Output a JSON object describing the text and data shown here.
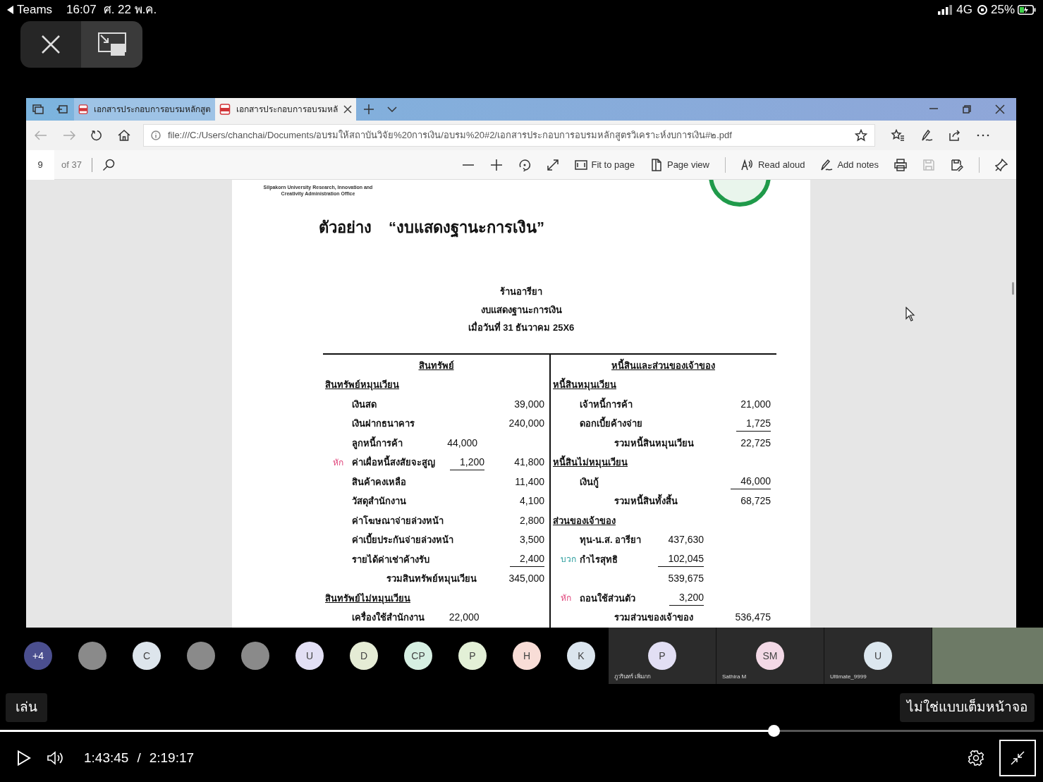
{
  "status_bar": {
    "app": "Teams",
    "time": "16:07",
    "date": "ศ. 22 พ.ค.",
    "network": "4G",
    "battery": "25%"
  },
  "browser": {
    "tabs": [
      {
        "label": "เอกสารประกอบการอบรมหลักสูต",
        "selected": false
      },
      {
        "label": "เอกสารประกอบการอบรมหลั",
        "selected": true
      }
    ],
    "address": "file:///C:/Users/chanchai/Documents/อบรมให้สถาบันวิจัย%20การเงิน/อบรม%20#2/เอกสารประกอบการอบรมหลักสูตรวิเคราะห์งบการเงิน#๒.pdf",
    "pdf_toolbar": {
      "page": "9",
      "page_count": "of 37",
      "buttons": [
        {
          "kind": "fit",
          "label": "Fit to page"
        },
        {
          "kind": "view",
          "label": "Page view"
        },
        {
          "kind": "read",
          "label": "Read aloud"
        },
        {
          "kind": "notes",
          "label": "Add notes"
        }
      ]
    }
  },
  "document": {
    "org": "Silpakorn University Research, Innovation and Creativity Administration Office",
    "title_prefix": "ตัวอย่าง",
    "title": "“งบแสดงฐานะการเงิน”",
    "header": [
      "ร้านอารียา",
      "งบแสดงฐานะการเงิน",
      "เมื่อวันที่ 31 ธันวาคม 25X6"
    ],
    "left": [
      {
        "kind": "heading",
        "label": "สินทรัพย์"
      },
      {
        "kind": "section",
        "label": "สินทรัพย์หมุนเวียน"
      },
      {
        "kind": "item",
        "label": "เงินสด",
        "b": "39,000",
        "b_ruled": false
      },
      {
        "kind": "item",
        "label": "เงินฝากธนาคาร",
        "b": "240,000",
        "b_ruled": false
      },
      {
        "kind": "item",
        "label": "ลูกหนี้การค้า",
        "a": "44,000",
        "a_ruled": false
      },
      {
        "kind": "item",
        "prefix": "หัก",
        "color": "#e0457b",
        "label": "ค่าเผื่อหนี้สงสัยจะสูญ",
        "a": "1,200",
        "a_ruled": true,
        "b": "41,800",
        "b_ruled": false
      },
      {
        "kind": "item",
        "label": "สินค้าคงเหลือ",
        "b": "11,400",
        "b_ruled": false
      },
      {
        "kind": "item",
        "label": "วัสดุสำนักงาน",
        "b": "4,100",
        "b_ruled": false
      },
      {
        "kind": "item",
        "label": "ค่าโฆษณาจ่ายล่วงหน้า",
        "b": "2,800",
        "b_ruled": false
      },
      {
        "kind": "item",
        "label": "ค่าเบี้ยประกันจ่ายล่วงหน้า",
        "b": "3,500",
        "b_ruled": false
      },
      {
        "kind": "item",
        "label": "รายได้ค่าเช่าค้างรับ",
        "b": "2,400",
        "b_ruled": true
      },
      {
        "kind": "total",
        "label": "รวมสินทรัพย์หมุนเวียน",
        "b": "345,000",
        "b_ruled": false
      },
      {
        "kind": "section",
        "label": "สินทรัพย์ไม่หมุนเวียน"
      },
      {
        "kind": "item",
        "label": "เครื่องใช้สำนักงาน",
        "a": "22,000",
        "a_ruled": false
      }
    ],
    "right": [
      {
        "kind": "heading",
        "label": "หนี้สินและส่วนของเจ้าของ"
      },
      {
        "kind": "section",
        "label": "หนี้สินหมุนเวียน"
      },
      {
        "kind": "item",
        "label": "เจ้าหนี้การค้า",
        "b": "21,000",
        "b_ruled": false
      },
      {
        "kind": "item",
        "label": "ดอกเบี้ยค้างจ่าย",
        "b": "1,725",
        "b_ruled": true
      },
      {
        "kind": "total",
        "label": "รวมหนี้สินหมุนเวียน",
        "b": "22,725",
        "b_ruled": false
      },
      {
        "kind": "section",
        "label": "หนี้สินไม่หมุนเวียน"
      },
      {
        "kind": "item",
        "label": "เงินกู้",
        "b": "46,000",
        "b_ruled": true
      },
      {
        "kind": "total",
        "label": "รวมหนี้สินทั้งสิ้น",
        "b": "68,725",
        "b_ruled": false
      },
      {
        "kind": "section",
        "label": "ส่วนของเจ้าของ"
      },
      {
        "kind": "item",
        "label": "ทุน-น.ส. อารียา",
        "a": "437,630",
        "a_ruled": false
      },
      {
        "kind": "item",
        "prefix": "บวก",
        "color": "#2a9d9d",
        "label": "กำไรสุทธิ",
        "a": "102,045",
        "a_ruled": true
      },
      {
        "kind": "item",
        "a": "539,675",
        "a_ruled": false
      },
      {
        "kind": "item",
        "prefix": "หัก",
        "color": "#e0457b",
        "label": "ถอนใช้ส่วนตัว",
        "a": "3,200",
        "a_ruled": true
      },
      {
        "kind": "total",
        "label": "รวมส่วนของเจ้าของ",
        "b": "536,475",
        "b_ruled": false
      }
    ]
  },
  "participants": [
    {
      "kind": "overflow",
      "initials": "+4",
      "color": "#4b4f8f"
    },
    {
      "kind": "photo"
    },
    {
      "kind": "initials",
      "initials": "C",
      "color": "#dde5ec"
    },
    {
      "kind": "photo"
    },
    {
      "kind": "photo"
    },
    {
      "kind": "initials",
      "initials": "U",
      "color": "#e2dff4"
    },
    {
      "kind": "initials",
      "initials": "D",
      "color": "#e5ecd5"
    },
    {
      "kind": "initials",
      "initials": "CP",
      "color": "#d6efe2"
    },
    {
      "kind": "initials",
      "initials": "P",
      "color": "#e3f0d7"
    },
    {
      "kind": "initials",
      "initials": "H",
      "color": "#f8ddd7"
    },
    {
      "kind": "initials",
      "initials": "K",
      "color": "#dbe5ee"
    }
  ],
  "tiles": [
    {
      "kind": "initials",
      "initials": "P",
      "name": "ภูวรินทร์ เพิ่มภก",
      "color": "#e2dff4"
    },
    {
      "kind": "initials",
      "initials": "SM",
      "name": "Sathira M",
      "color": "#f3d9e6"
    },
    {
      "kind": "initials",
      "initials": "U",
      "name": "Ultimate_9999",
      "color": "#dce7ef"
    },
    {
      "kind": "video"
    }
  ],
  "player": {
    "play_tooltip": "เล่น",
    "fullscreen_tooltip": "ไม่ใช่แบบเต็มหน้าจอ",
    "level": 0.742,
    "current": "1:43:45",
    "separator": "/",
    "total": "2:19:17"
  }
}
